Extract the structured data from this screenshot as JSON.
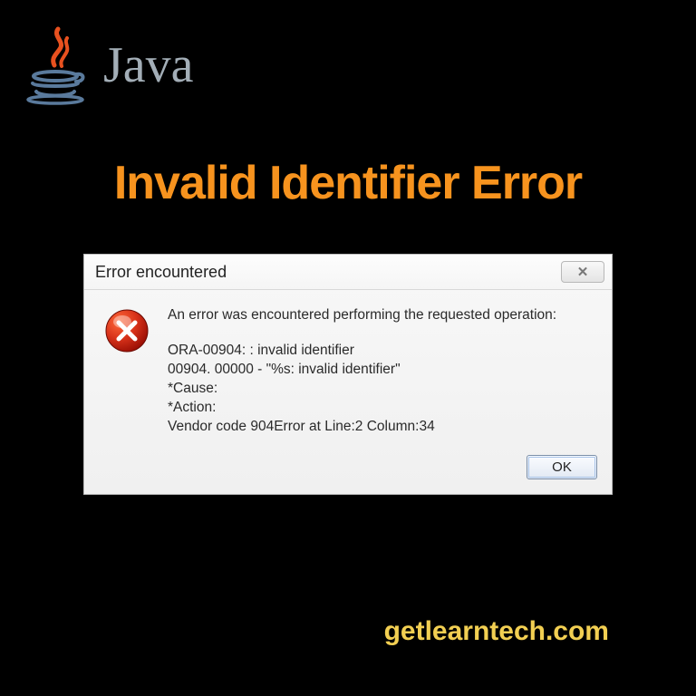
{
  "header": {
    "logo_label": "Java"
  },
  "title": "Invalid Identifier Error",
  "dialog": {
    "window_title": "Error encountered",
    "close_glyph": "✕",
    "message_intro": "An error was encountered performing the requested operation:",
    "error_lines": [
      "ORA-00904: : invalid identifier",
      "00904. 00000 -  \"%s: invalid identifier\"",
      "*Cause:",
      "*Action:",
      "Vendor code 904Error at Line:2 Column:34"
    ],
    "ok_label": "OK"
  },
  "footer": {
    "site": "getlearntech.com"
  }
}
